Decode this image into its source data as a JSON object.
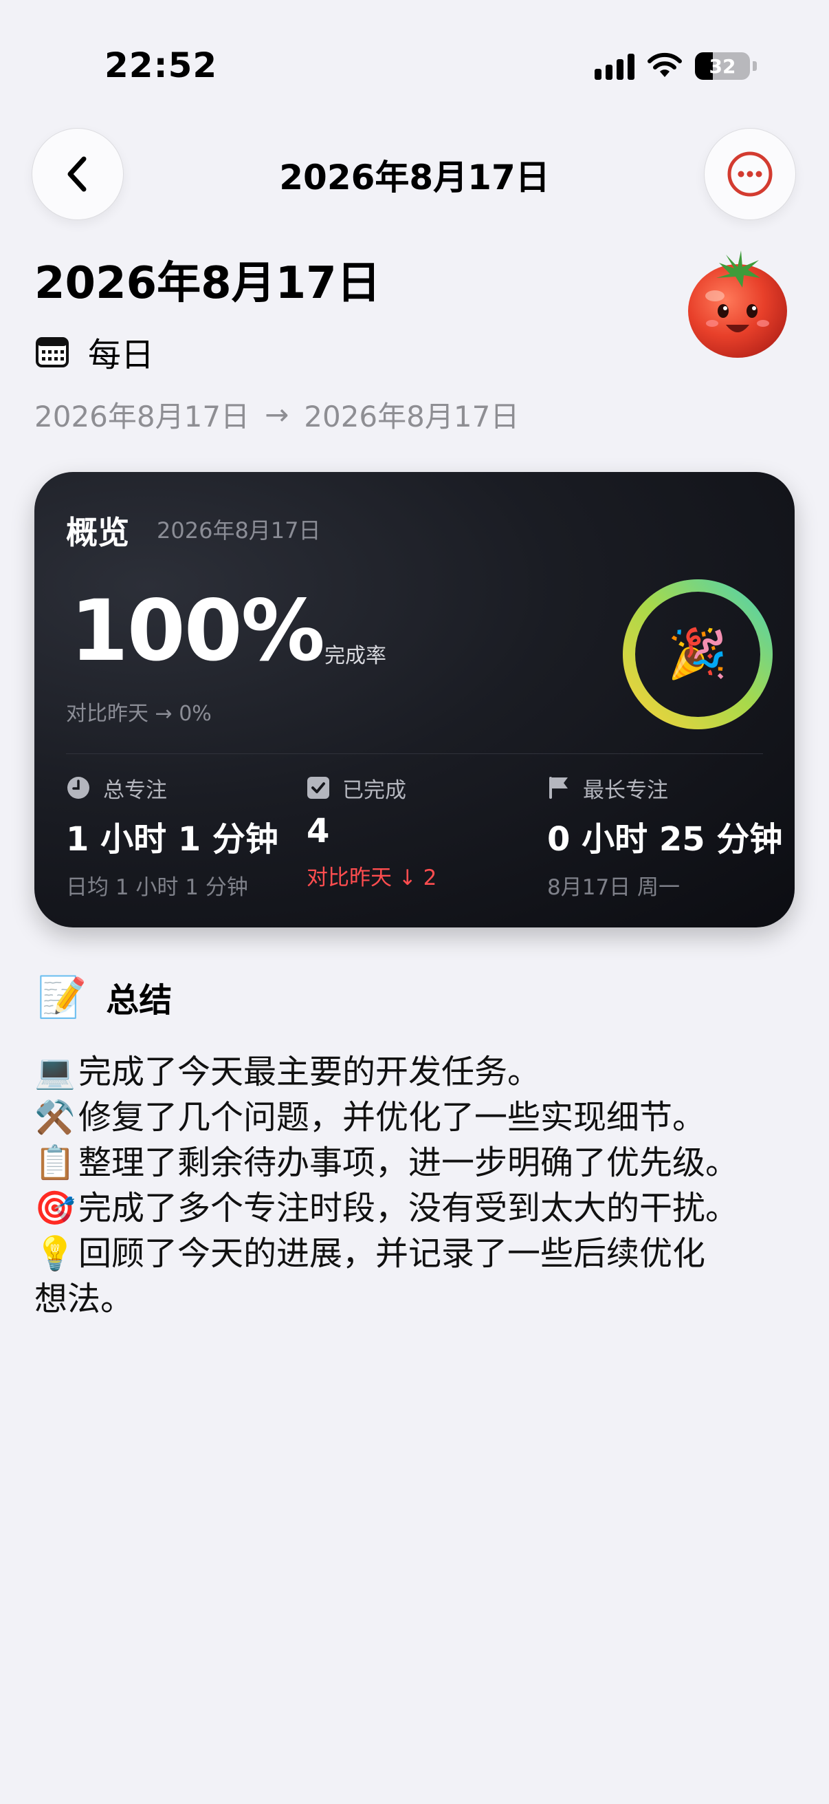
{
  "status_bar": {
    "time": "22:52",
    "battery_level": "32",
    "battery_fraction": 0.32
  },
  "nav": {
    "title": "2026年8月17日",
    "back_icon": "chevron-left-icon",
    "more_icon": "ellipsis-circle-icon",
    "accent_color": "#d33b30"
  },
  "header": {
    "title": "2026年8月17日",
    "frequency": "每日",
    "range_start": "2026年8月17日",
    "range_arrow": "→",
    "range_end": "2026年8月17日",
    "mascot": "tomato-mascot"
  },
  "overview": {
    "title": "概览",
    "date": "2026年8月17日",
    "completion": "100%",
    "completion_fraction": 1.0,
    "completion_label": "完成率",
    "compare_yesterday": "对比昨天 → 0%",
    "ring_emoji": "🎉",
    "stats": [
      {
        "icon": "clock-icon",
        "label": "总专注",
        "value": "1 小时 1 分钟",
        "sub": "日均 1 小时 1 分钟",
        "sub_color": "#7f818a"
      },
      {
        "icon": "checkbox-icon",
        "label": "已完成",
        "value": "4",
        "sub": "对比昨天 ↓ 2",
        "sub_color": "#ff4d4f"
      },
      {
        "icon": "flag-icon",
        "label": "最长专注",
        "value": "0 小时 25 分钟",
        "sub": "8月17日 周一",
        "sub_color": "#7f818a"
      }
    ]
  },
  "summary": {
    "title": "总结",
    "icon": "📝",
    "lines": [
      {
        "emoji": "💻",
        "text": "完成了今天最主要的开发任务。"
      },
      {
        "emoji": "⚒️",
        "text": "修复了几个问题，并优化了一些实现细节。"
      },
      {
        "emoji": "📋",
        "text": "整理了剩余待办事项，进一步明确了优先级。"
      },
      {
        "emoji": "🎯",
        "text": "完成了多个专注时段，没有受到太大的干扰。"
      },
      {
        "emoji": "💡",
        "text": "回顾了今天的进展，并记录了一些后续优化"
      },
      {
        "emoji": "",
        "text": "想法。"
      }
    ]
  }
}
